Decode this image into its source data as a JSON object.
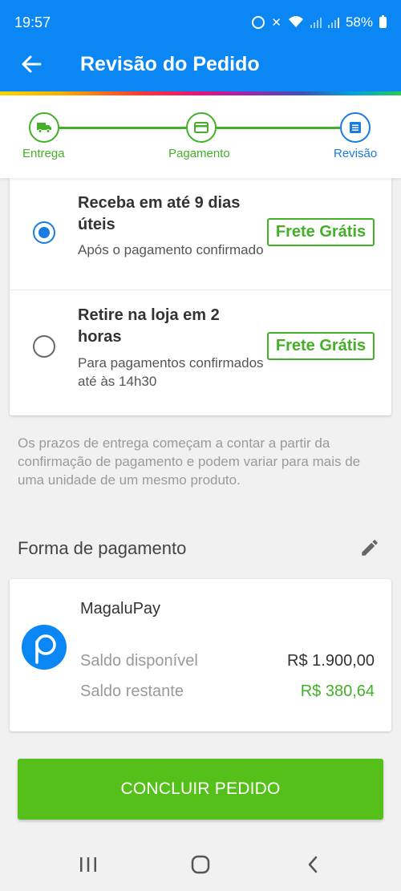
{
  "status": {
    "time": "19:57",
    "battery": "58%"
  },
  "header": {
    "title": "Revisão do Pedido"
  },
  "stepper": {
    "steps": [
      {
        "label": "Entrega",
        "state": "done",
        "icon": "truck-icon"
      },
      {
        "label": "Pagamento",
        "state": "done",
        "icon": "card-icon"
      },
      {
        "label": "Revisão",
        "state": "current",
        "icon": "document-icon"
      }
    ]
  },
  "delivery": {
    "options": [
      {
        "title": "Receba em até 9 dias úteis",
        "subtitle": "Após o pagamento confirmado",
        "badge": "Frete Grátis",
        "selected": true
      },
      {
        "title": "Retire na loja em 2 horas",
        "subtitle": "Para pagamentos confirmados até às 14h30",
        "badge": "Frete Grátis",
        "selected": false
      }
    ],
    "notice": "Os prazos de entrega começam a contar a partir da confirmação de pagamento e podem variar para mais de uma unidade de um mesmo produto."
  },
  "payment": {
    "section_title": "Forma de pagamento",
    "method": "MagaluPay",
    "available_label": "Saldo disponível",
    "available_value": "R$ 1.900,00",
    "remaining_label": "Saldo restante",
    "remaining_value": "R$ 380,64"
  },
  "cta": {
    "label": "CONCLUIR PEDIDO"
  },
  "colors": {
    "primary": "#0a86f5",
    "green": "#43b028",
    "cta": "#56c01a",
    "current_step": "#1a7be0"
  }
}
